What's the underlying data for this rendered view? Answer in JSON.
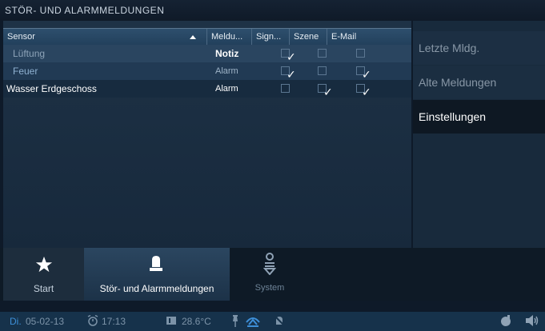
{
  "title": "STÖR- UND ALARMMELDUNGEN",
  "table": {
    "headers": [
      "Sensor",
      "Meldu...",
      "Sign...",
      "Szene",
      "E-Mail"
    ],
    "rows": [
      {
        "sensor": "Lüftung",
        "meldung": "Notiz",
        "signal": true,
        "szene": false,
        "email": false
      },
      {
        "sensor": "Feuer",
        "meldung": "Alarm",
        "signal": true,
        "szene": false,
        "email": true
      },
      {
        "sensor": "Wasser Erdgeschoss",
        "meldung": "Alarm",
        "signal": false,
        "szene": true,
        "email": true
      }
    ]
  },
  "side_menu": {
    "items": [
      "Letzte Mldg.",
      "Alte Meldungen",
      "Einstellungen"
    ],
    "active": "Einstellungen"
  },
  "nav": {
    "items": [
      {
        "label": "Start",
        "icon": "star-icon"
      },
      {
        "label": "Stör- und Alarmmeldungen",
        "icon": "alarm-beacon-icon"
      },
      {
        "label": "System",
        "icon": "system-icon"
      }
    ],
    "active": "Stör- und Alarmmeldungen"
  },
  "status": {
    "day": "Di.",
    "date": "05-02-13",
    "time": "17:13",
    "temperature": "28.6°C"
  },
  "colors": {
    "accent": "#2e4f6d",
    "row_highlight": "#2a4560",
    "status_text": "#7c93a8"
  }
}
